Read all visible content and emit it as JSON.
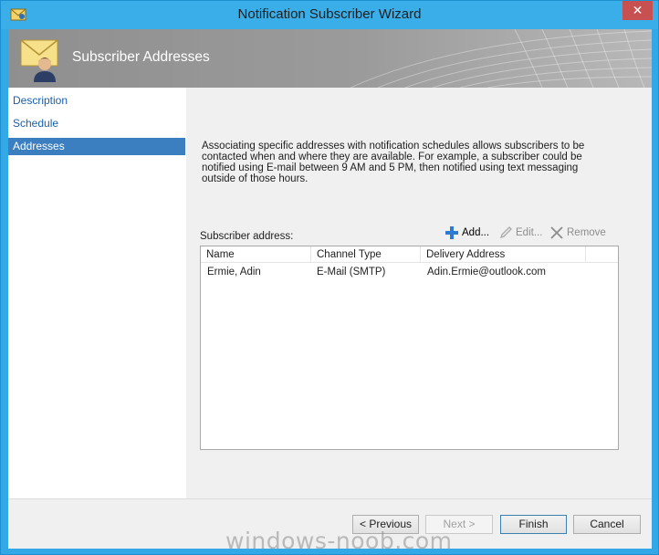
{
  "window": {
    "title": "Notification Subscriber Wizard",
    "close_glyph": "✕"
  },
  "header": {
    "title": "Subscriber Addresses",
    "icon": "envelope-user-icon"
  },
  "nav": {
    "items": [
      {
        "label": "Description"
      },
      {
        "label": "Schedule"
      },
      {
        "label": "Addresses"
      }
    ],
    "active_index": 2
  },
  "content": {
    "description": "Associating specific addresses with notification schedules allows subscribers to be contacted when and where they are available. For example, a subscriber could be notified using E-mail between 9 AM and 5 PM, then notified using text messaging outside of those hours.",
    "subscriber_label": "Subscriber address:",
    "toolbar": {
      "add_label": "Add...",
      "edit_label": "Edit...",
      "remove_label": "Remove"
    },
    "table": {
      "headers": [
        "Name",
        "Channel Type",
        "Delivery Address"
      ],
      "rows": [
        [
          "Ermie, Adin",
          "E-Mail (SMTP)",
          "Adin.Ermie@outlook.com"
        ]
      ]
    }
  },
  "footer": {
    "previous_label": "< Previous",
    "next_label": "Next >",
    "finish_label": "Finish",
    "cancel_label": "Cancel"
  },
  "watermark": "windows-noob.com",
  "colors": {
    "title_bar": "#3aaee8",
    "close_button": "#c75050",
    "nav_active": "#3c7fc0",
    "nav_link": "#1a5ea8"
  }
}
